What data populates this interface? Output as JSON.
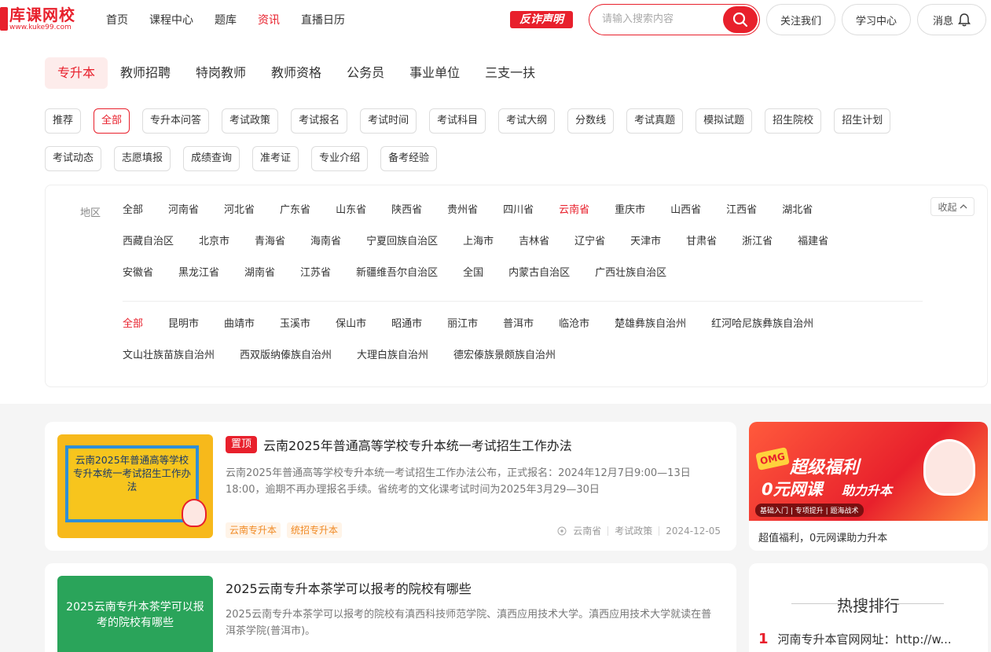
{
  "logo": {
    "title": "库课网校",
    "url": "www.kuke99.com"
  },
  "nav": [
    "首页",
    "课程中心",
    "题库",
    "资讯",
    "直播日历"
  ],
  "nav_active_index": 3,
  "fanzha": "反诈声明",
  "search": {
    "placeholder": "请输入搜索内容"
  },
  "header_buttons": {
    "follow": "关注我们",
    "learn": "学习中心",
    "message": "消息"
  },
  "category_tabs": [
    "专升本",
    "教师招聘",
    "特岗教师",
    "教师资格",
    "公务员",
    "事业单位",
    "三支一扶"
  ],
  "filter_chips_row1": [
    "推荐",
    "全部",
    "专升本问答",
    "考试政策",
    "考试报名",
    "考试时间",
    "考试科目",
    "考试大纲",
    "分数线",
    "考试真题",
    "模拟试题",
    "招生院校",
    "招生计划"
  ],
  "filter_chips_row2": [
    "考试动态",
    "志愿填报",
    "成绩查询",
    "准考证",
    "专业介绍",
    "备考经验"
  ],
  "region": {
    "label": "地区",
    "collapse": "收起",
    "provinces": [
      "全部",
      "河南省",
      "河北省",
      "广东省",
      "山东省",
      "陕西省",
      "贵州省",
      "四川省",
      "云南省",
      "重庆市",
      "山西省",
      "江西省",
      "湖北省",
      "西藏自治区",
      "北京市",
      "青海省",
      "海南省",
      "宁夏回族自治区",
      "上海市",
      "吉林省",
      "辽宁省",
      "天津市",
      "甘肃省",
      "浙江省",
      "福建省",
      "安徽省",
      "黑龙江省",
      "湖南省",
      "江苏省",
      "新疆维吾尔自治区",
      "全国",
      "内蒙古自治区",
      "广西壮族自治区"
    ],
    "active_province": "云南省",
    "cities": [
      "全部",
      "昆明市",
      "曲靖市",
      "玉溪市",
      "保山市",
      "昭通市",
      "丽江市",
      "普洱市",
      "临沧市",
      "楚雄彝族自治州",
      "红河哈尼族彝族自治州",
      "文山壮族苗族自治州",
      "西双版纳傣族自治州",
      "大理白族自治州",
      "德宏傣族景颇族自治州"
    ],
    "active_city": "全部"
  },
  "articles": [
    {
      "pinned": "置顶",
      "title": "云南2025年普通高等学校专升本统一考试招生工作办法",
      "thumb_text": "云南2025年普通高等学校专升本统一考试招生工作办法",
      "desc": "云南2025年普通高等学校专升本统一考试招生工作办法公布，正式报名：2024年12月7日9:00—13日18:00，逾期不再办理报名手续。省统考的文化课考试时间为2025年3月29—30日",
      "tags": [
        "云南专升本",
        "统招专升本"
      ],
      "location": "云南省",
      "category": "考试政策",
      "date": "2024-12-05"
    },
    {
      "title": "2025云南专升本茶学可以报考的院校有哪些",
      "thumb_text": "2025云南专升本茶学可以报考的院校有哪些",
      "desc": "2025云南专升本茶学可以报考的院校有滇西科技师范学院、滇西应用技术大学。滇西应用技术大学就读在普洱茶学院(普洱市)。"
    }
  ],
  "promo": {
    "badge": "OMG",
    "headline1": "超级福利",
    "headline2": "0元网课",
    "headline3": "助力升本",
    "sub": "基础入门 | 专项提升 | 题海战术",
    "caption": "超值福利，0元网课助力升本"
  },
  "hot": {
    "title": "热搜排行",
    "items": [
      {
        "rank": "1",
        "text": "河南专升本官网网址：http://w..."
      }
    ]
  },
  "colors": {
    "brand": "#e8202c",
    "tag_orange": "#f08a24"
  }
}
